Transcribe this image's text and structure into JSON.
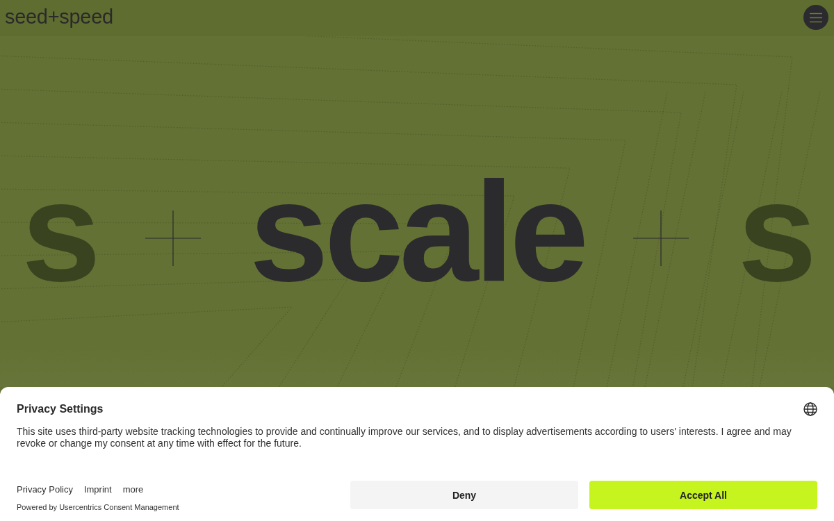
{
  "header": {
    "logo": "seed+speed"
  },
  "hero": {
    "words": [
      {
        "text": "s",
        "faded": true
      },
      {
        "text": "scale",
        "faded": false
      },
      {
        "text": "s",
        "faded": true
      }
    ]
  },
  "consent_banner": {
    "title": "Privacy Settings",
    "body": "This site uses third-party website tracking technologies to provide and continually improve our services, and to display advertisements according to users' interests. I agree and may revoke or change my consent at any time with effect for the future.",
    "links": [
      "Privacy Policy",
      "Imprint",
      "more"
    ],
    "powered_by": "Powered by Usercentrics Consent Management",
    "buttons": [
      {
        "label": "Deny",
        "kind": "secondary"
      },
      {
        "label": "Accept All",
        "kind": "primary"
      }
    ]
  }
}
